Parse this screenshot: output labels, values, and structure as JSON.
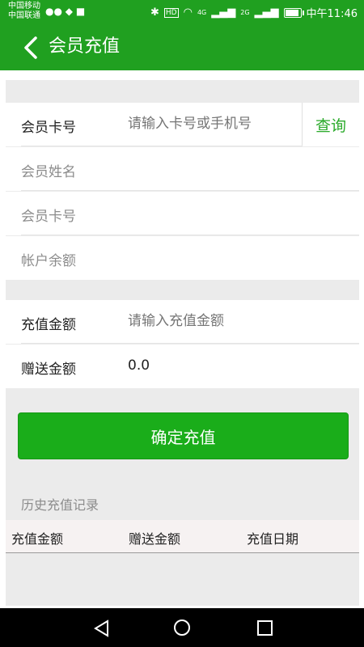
{
  "status_bar": {
    "carrier1": "中国移动",
    "carrier2": "中国联通",
    "time": "中午11:46",
    "hd": "HD",
    "net1": "4G",
    "net2": "2G"
  },
  "header": {
    "title": "会员充值"
  },
  "member": {
    "card_label": "会员卡号",
    "card_placeholder": "请输入卡号或手机号",
    "query_label": "查询",
    "name_label": "会员姓名",
    "card_no_label": "会员卡号",
    "balance_label": "帐户余额"
  },
  "recharge": {
    "amount_label": "充值金额",
    "amount_placeholder": "请输入充值金额",
    "gift_label": "赠送金额",
    "gift_value": "0.0"
  },
  "confirm_label": "确定充值",
  "history": {
    "title": "历史充值记录",
    "columns": [
      "充值金额",
      "赠送金额",
      "充值日期"
    ]
  },
  "colors": {
    "primary": "#20a020",
    "button": "#1aad1a",
    "query_text": "#2aaa2a"
  }
}
